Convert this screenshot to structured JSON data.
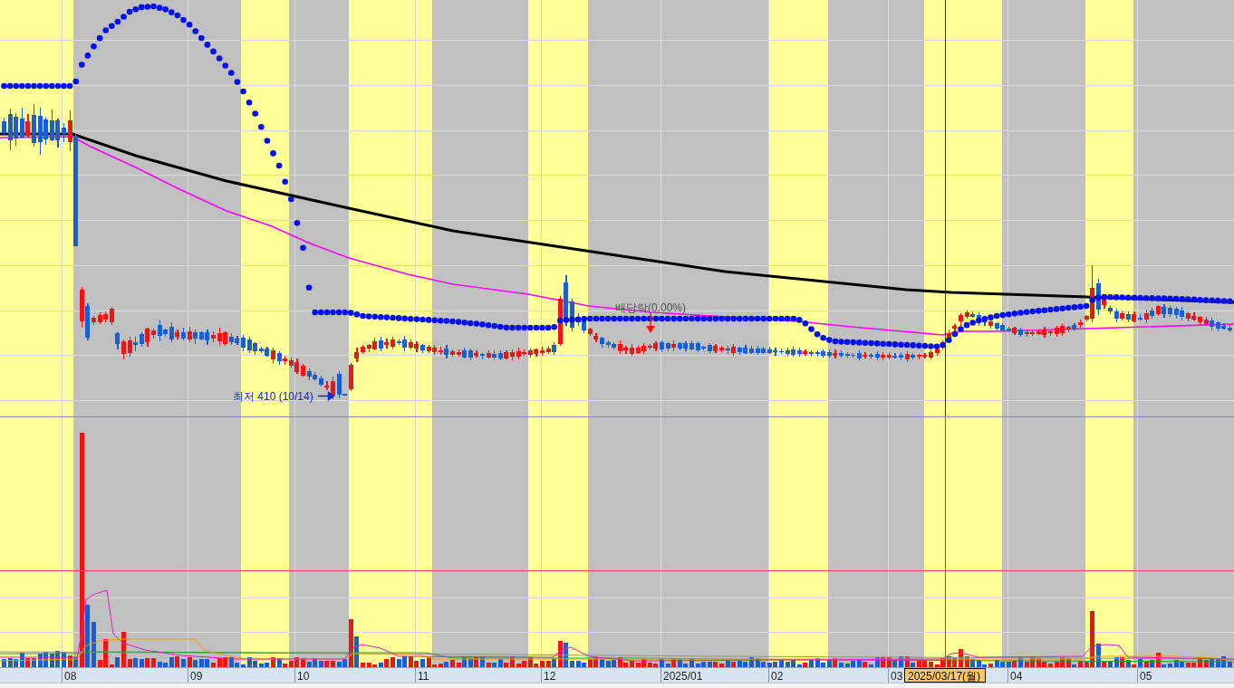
{
  "chart": {
    "annotations": [
      {
        "kind": "low_price",
        "text": "최저 410 (10/14)"
      },
      {
        "kind": "ex_dividend",
        "text": "배당락(0.00%)"
      }
    ]
  },
  "x_axis": {
    "labels": [
      "08",
      "09",
      "10",
      "11",
      "12",
      "2025/01",
      "02",
      "03",
      "04",
      "05"
    ],
    "cursor_label": "2025/03/17(월)"
  }
}
